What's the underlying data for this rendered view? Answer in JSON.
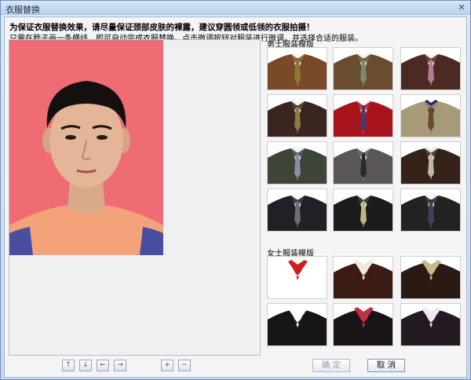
{
  "window": {
    "title": "衣服替换",
    "close_glyph": "✕"
  },
  "instructions": {
    "line1": "为保证衣服替换效果，请尽量保证颈部皮肤的裸露，建议穿圆领或低领的衣服拍摄！",
    "line2": "只需在脖子画一条横线，即可自动完成衣服替换。点击微调按钮对服装进行微调，并选择合适的服装。"
  },
  "sections": {
    "men_label": "男士服装模版",
    "women_label": "女士服装模版"
  },
  "men_templates": [
    {
      "jacket": "#7a4a28",
      "shirt": "#f6f6f2",
      "tie": "#8a7a3a"
    },
    {
      "jacket": "#6a4c30",
      "shirt": "#f4f2ec",
      "tie": "#7d8a70"
    },
    {
      "jacket": "#4a2a22",
      "shirt": "#f6f2f2",
      "tie": "#b08090"
    },
    {
      "jacket": "#3a2620",
      "shirt": "#f2f0ea",
      "tie": "#8a7c3e"
    },
    {
      "jacket": "#a8141c",
      "shirt": "#f8f8f8",
      "tie": "#4a3a6a"
    },
    {
      "jacket": "#a79a78",
      "shirt": "#1f2a6a",
      "tie": "#6a4a2a"
    },
    {
      "jacket": "#3d4438",
      "shirt": "#f0f0ea",
      "tie": "#8890a8"
    },
    {
      "jacket": "#5a5658",
      "shirt": "#f2f2f2",
      "tie": "#2a2a30"
    },
    {
      "jacket": "#352218",
      "shirt": "#e8e4da",
      "tie": "#c0b8a0"
    },
    {
      "jacket": "#1f2126",
      "shirt": "#f8f8f8",
      "tie": "#6a6c78"
    },
    {
      "jacket": "#1c1c1c",
      "shirt": "#f4f4f4",
      "tie": "#c0b48a"
    },
    {
      "jacket": "#222222",
      "shirt": "#f4f4f4",
      "tie": "#3a4458"
    }
  ],
  "women_templates": [
    {
      "jacket": "#ffffff",
      "shirt": "#cc2020",
      "tie": "none"
    },
    {
      "jacket": "#3a1c14",
      "shirt": "#efe8d8",
      "tie": "none"
    },
    {
      "jacket": "#2a1a12",
      "shirt": "#c8b88a",
      "tie": "none"
    },
    {
      "jacket": "#161616",
      "shirt": "#ffffff",
      "tie": "none"
    },
    {
      "jacket": "#1a1416",
      "shirt": "#c03040",
      "tie": "none"
    },
    {
      "jacket": "#241a24",
      "shirt": "#eee8ee",
      "tie": "none"
    }
  ],
  "toolbar": {
    "up": "↑",
    "down": "↓",
    "left": "←",
    "right": "→",
    "zoom_in": "+",
    "zoom_out": "−"
  },
  "buttons": {
    "confirm": "确  定",
    "cancel": "取  消"
  },
  "colors": {
    "photo_background": "#ef6c74",
    "shirt": "#f3a27a",
    "accent": "#2a3fa8"
  }
}
